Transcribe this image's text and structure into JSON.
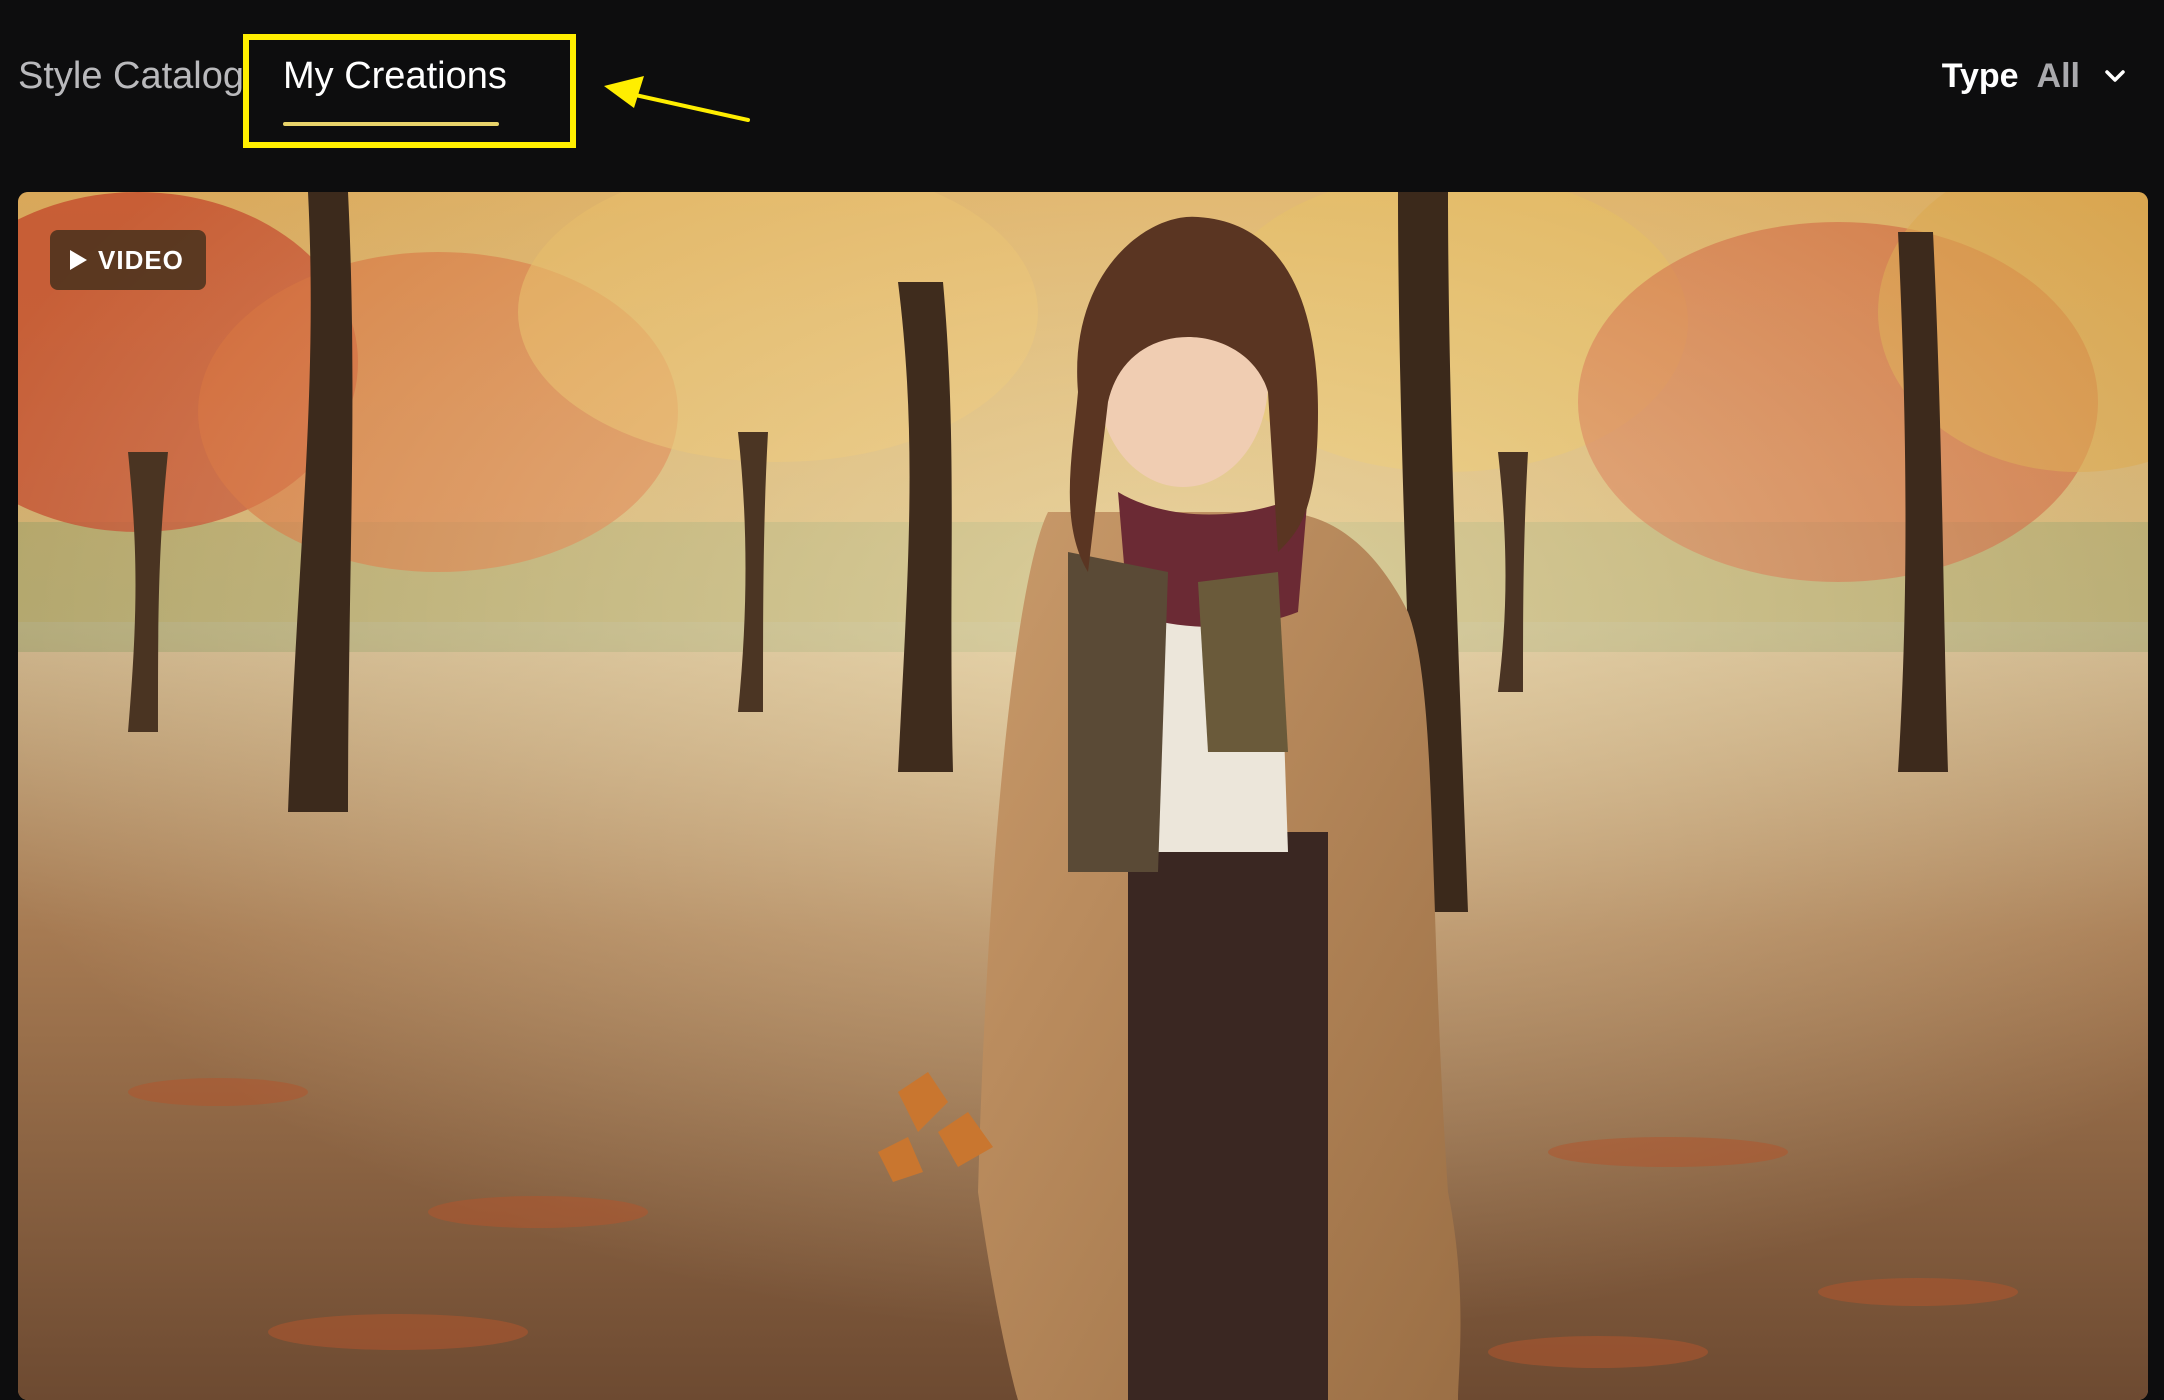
{
  "tabs": [
    {
      "label": "Style Catalog",
      "active": false
    },
    {
      "label": "My Creations",
      "active": true
    }
  ],
  "filter": {
    "label": "Type",
    "value": "All"
  },
  "media": {
    "badge": "VIDEO"
  },
  "colors": {
    "background": "#0d0d0e",
    "active_underline": "#e8d36a",
    "annotation": "#ffee00"
  },
  "icons": {
    "filter_dropdown": "chevron-down-icon",
    "badge": "play-icon",
    "annotation": "arrow-icon"
  }
}
